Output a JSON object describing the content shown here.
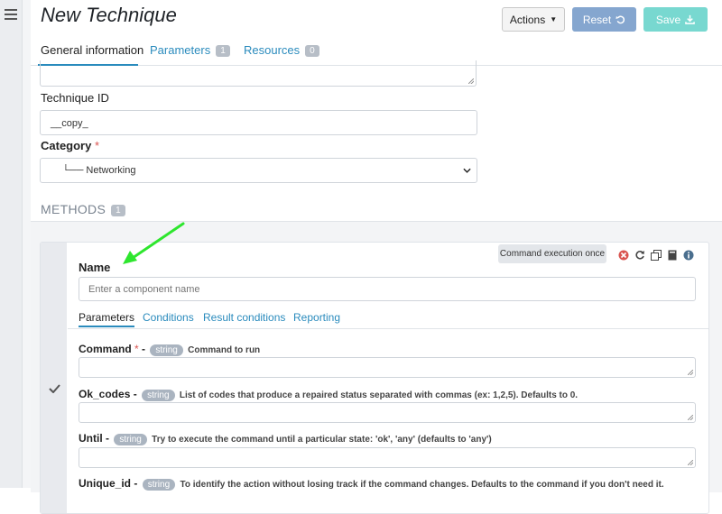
{
  "header": {
    "title": "New Technique",
    "actions_label": "Actions",
    "reset_label": "Reset",
    "save_label": "Save"
  },
  "tabs": [
    {
      "label": "General information",
      "active": true
    },
    {
      "label": "Parameters",
      "count": "1"
    },
    {
      "label": "Resources",
      "count": "0"
    }
  ],
  "form": {
    "technique_id_label": "Technique ID",
    "technique_id_value": "__copy_",
    "category_label": "Category",
    "category_value": "└── Networking"
  },
  "methods": {
    "label": "METHODS",
    "count": "1"
  },
  "method": {
    "tooltip": "Command execution once",
    "name_label": "Name",
    "name_placeholder": "Enter a component name",
    "tabs": [
      {
        "label": "Parameters",
        "active": true
      },
      {
        "label": "Conditions"
      },
      {
        "label": "Result conditions"
      },
      {
        "label": "Reporting"
      }
    ],
    "params": [
      {
        "name": "Command",
        "required": true,
        "type": "string",
        "desc": "Command to run"
      },
      {
        "name": "Ok_codes",
        "type": "string",
        "desc": "List of codes that produce a repaired status separated with commas (ex: 1,2,5). Defaults to 0."
      },
      {
        "name": "Until",
        "type": "string",
        "desc": "Try to execute the command until a particular state: 'ok', 'any' (defaults to 'any')"
      },
      {
        "name": "Unique_id",
        "type": "string",
        "desc": "To identify the action without losing track if the command changes. Defaults to the command if you don't need it."
      }
    ]
  },
  "colors": {
    "accent": "#2a8bbd",
    "reset": "#85a6cf",
    "save": "#78d8d0",
    "required": "#d9534f",
    "arrow": "#2ee62e"
  }
}
